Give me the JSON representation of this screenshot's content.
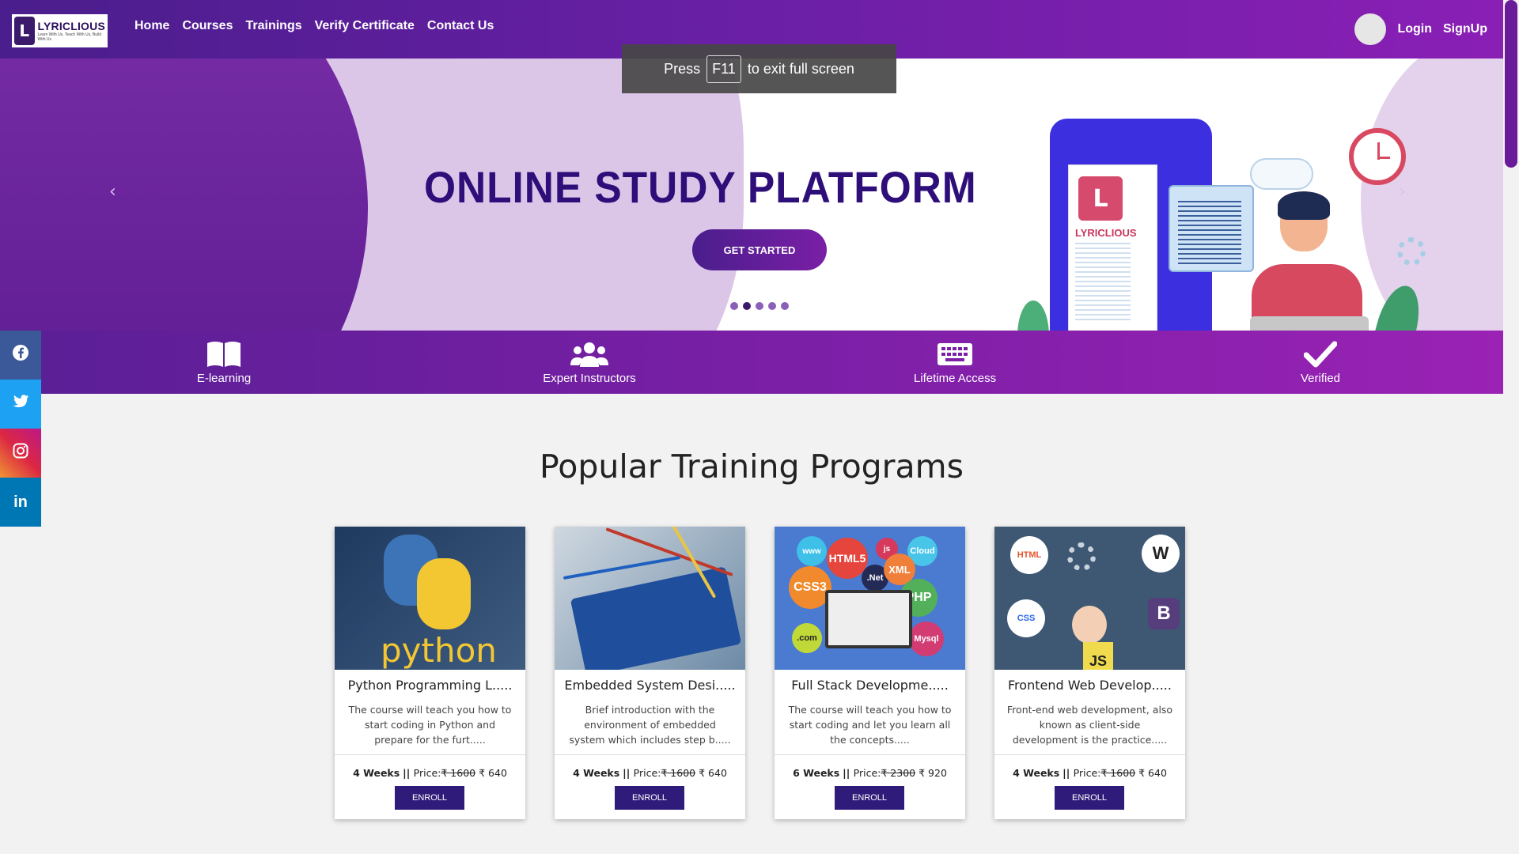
{
  "brand": {
    "name": "LYRICLIOUS",
    "tagline": "Learn With Us, Teach With Us, Build With Us",
    "mark": "L"
  },
  "nav": {
    "items": [
      {
        "label": "Home"
      },
      {
        "label": "Courses"
      },
      {
        "label": "Trainings"
      },
      {
        "label": "Verify Certificate"
      },
      {
        "label": "Contact Us"
      }
    ],
    "login": "Login",
    "signup": "SignUp"
  },
  "toast": {
    "prefix": "Press",
    "key": "F11",
    "suffix": "to exit full screen"
  },
  "hero": {
    "title": "ONLINE STUDY PLATFORM",
    "cta": "GET STARTED",
    "slide_count": 5,
    "active_slide": 2,
    "prev_arrow": "‹",
    "next_arrow": "›",
    "illustration_brand": "LYRICLIOUS"
  },
  "features": [
    {
      "label": "E-learning",
      "icon": "book-icon"
    },
    {
      "label": "Expert Instructors",
      "icon": "users-icon"
    },
    {
      "label": "Lifetime Access",
      "icon": "keyboard-icon"
    },
    {
      "label": "Verified",
      "icon": "check-icon"
    }
  ],
  "social": [
    {
      "name": "facebook",
      "glyph": "f",
      "color": "#3b5998"
    },
    {
      "name": "twitter",
      "glyph": "t",
      "color": "#1da1f2"
    },
    {
      "name": "instagram",
      "glyph": "◎",
      "color": "#dc2743"
    },
    {
      "name": "linkedin",
      "glyph": "in",
      "color": "#0077b5"
    }
  ],
  "section": {
    "title": "Popular Training Programs"
  },
  "courses": [
    {
      "title": "Python Programming L.....",
      "description": "The course will teach you how to start coding in Python and prepare for the furt.....",
      "weeks": "4 Weeks",
      "price_label": "Price:",
      "old_price": "₹ 1600",
      "new_price": "₹ 640",
      "button": "ENROLL",
      "image_text": "python"
    },
    {
      "title": "Embedded System Desi.....",
      "description": "Brief introduction with the environment of embedded system which includes step b.....",
      "weeks": "4 Weeks",
      "price_label": "Price:",
      "old_price": "₹ 1600",
      "new_price": "₹ 640",
      "button": "ENROLL"
    },
    {
      "title": "Full Stack Developme.....",
      "description": "The course will teach you how to start coding and let you learn all the concepts.....",
      "weeks": "6 Weeks",
      "price_label": "Price:",
      "old_price": "₹ 2300",
      "new_price": "₹ 920",
      "button": "ENROLL",
      "image_tags": [
        "www",
        "HTML5",
        "js",
        "Cloud",
        "CSS3",
        ".Net",
        "XML",
        "PHP",
        ".com",
        "Mysql"
      ]
    },
    {
      "title": "Frontend Web Develop.....",
      "description": "Front-end web development, also known as client-side development is the practice.....",
      "weeks": "4 Weeks",
      "price_label": "Price:",
      "old_price": "₹ 1600",
      "new_price": "₹ 640",
      "button": "ENROLL",
      "image_tags": [
        "HTML",
        "CSS",
        "B",
        "JS"
      ]
    }
  ],
  "colors": {
    "primary": "#4a1e8c",
    "accent": "#7a1fa6",
    "button": "#2f1c7a",
    "title": "#2e0f7a"
  }
}
